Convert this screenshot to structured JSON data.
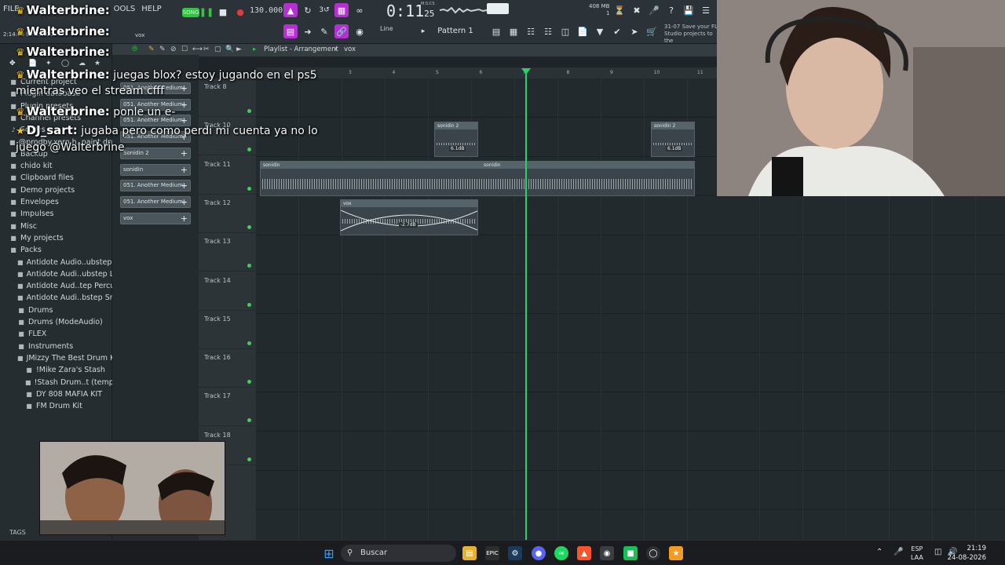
{
  "app": {
    "menu": [
      "FILE",
      "OOLS",
      "HELP"
    ],
    "time_main": "0:11",
    "time_small": "25",
    "time_label": "M:S:CS",
    "tempo": "130.000",
    "song_label": "SONG",
    "memory": [
      "408 MB",
      "1"
    ],
    "pattern": "Pattern 1",
    "snap": "Line",
    "hint": [
      "31-07  Save your FL",
      "Studio projects to the"
    ],
    "elapsed": "2:14:08 for 3:0:00",
    "vox_label": "vox"
  },
  "playlist": {
    "title": "Playlist - Arrangement",
    "current": "vox",
    "ruler": [
      "3",
      "4",
      "5",
      "6",
      "7",
      "8",
      "9",
      "10",
      "11"
    ],
    "tracks": [
      "Track 8",
      "Track 10",
      "Track 11",
      "Track 12",
      "Track 13",
      "Track 14",
      "Track 15",
      "Track 16",
      "Track 17",
      "Track 18"
    ],
    "clips": {
      "sonidin2_a": "sonidin 2",
      "sonidin2_b": "sonidin 2",
      "sonidin_a": "sonidin",
      "sonidin_b": "sonidin",
      "vox": "vox",
      "db_a": "6.1dB",
      "db_b": "6.1dB",
      "db_vox": "-2.7dB"
    }
  },
  "browser": {
    "items": [
      {
        "label": "Current project",
        "icon": "folder-icon"
      },
      {
        "label": "Plugin database",
        "icon": "folder-icon"
      },
      {
        "label": "Plugin presets",
        "icon": "folder-icon"
      },
      {
        "label": "Channel presets",
        "icon": "folder-icon"
      },
      {
        "label": "Scores",
        "icon": "note-icon"
      },
      {
        "label": "@prodby.xero h..paint drum kit",
        "icon": "folder-icon"
      },
      {
        "label": "Backup",
        "icon": "folder-icon"
      },
      {
        "label": "chido kit",
        "icon": "folder-icon"
      },
      {
        "label": "Clipboard files",
        "icon": "folder-icon"
      },
      {
        "label": "Demo projects",
        "icon": "folder-icon"
      },
      {
        "label": "Envelopes",
        "icon": "folder-icon"
      },
      {
        "label": "Impulses",
        "icon": "folder-icon"
      },
      {
        "label": "Misc",
        "icon": "folder-icon"
      },
      {
        "label": "My projects",
        "icon": "folder-icon"
      },
      {
        "label": "Packs",
        "icon": "folder-icon"
      },
      {
        "label": "Antidote Audio..ubstep Kicks",
        "icon": "folder-icon"
      },
      {
        "label": "Antidote Audi..ubstep Loops",
        "icon": "folder-icon"
      },
      {
        "label": "Antidote Aud..tep Percussion",
        "icon": "folder-icon"
      },
      {
        "label": "Antidote Audi..bstep Snares",
        "icon": "folder-icon"
      },
      {
        "label": "Drums",
        "icon": "folder-icon"
      },
      {
        "label": "Drums (ModeAudio)",
        "icon": "folder-icon"
      },
      {
        "label": "FLEX",
        "icon": "folder-icon"
      },
      {
        "label": "Instruments",
        "icon": "folder-icon"
      },
      {
        "label": "JMizzy The Best Drum Kits",
        "icon": "folder-icon"
      },
      {
        "label": "!Mike Zara's Stash",
        "icon": "folder-icon"
      },
      {
        "label": "!Stash Drum..t (template)",
        "icon": "folder-icon"
      },
      {
        "label": "DY 808 MAFIA KIT",
        "icon": "folder-icon"
      },
      {
        "label": "FM Drum Kit",
        "icon": "folder-icon"
      }
    ],
    "tags": "TAGS"
  },
  "channels": [
    "051. Another Medium..",
    "051. Another Medium..",
    "051. Another Medium..",
    "051. Another Medium..",
    "Sonidin 2",
    "sonidin",
    "051. Another Medium..",
    "051. Another Medium..",
    "vox"
  ],
  "chat": [
    {
      "user": "Walterbrine:",
      "text": ""
    },
    {
      "user": "Walterbrine:",
      "text": ""
    },
    {
      "user": "Walterbrine:",
      "text": ""
    },
    {
      "user": "Walterbrine:",
      "text": "juegas blox? estoy jugando en el ps5"
    },
    {
      "user": "",
      "text": "mientras veo el stream cfff"
    },
    {
      "user": "Walterbrine:",
      "text": "ponle un e-"
    },
    {
      "user": "DJ_sart:",
      "text": "jugaba pero como perdi mi cuenta ya no lo"
    },
    {
      "user": "",
      "text": "juego @Walterbrine"
    }
  ],
  "taskbar": {
    "search": "Buscar",
    "lang_top": "ESP",
    "lang_bottom": "LAA",
    "time": "21:19",
    "date": "24-08-2026"
  },
  "colors": {
    "accent": "#b52fd1",
    "playhead": "#29d36a",
    "record": "#e03b3b"
  }
}
